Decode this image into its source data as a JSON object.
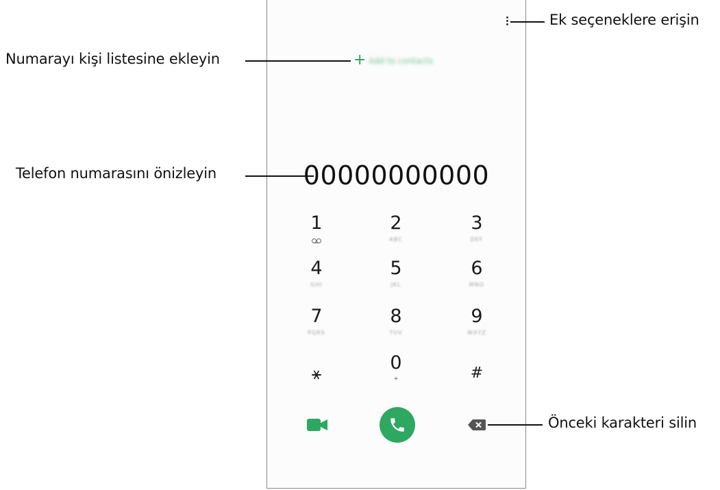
{
  "callouts": {
    "more_options": "Ek seçeneklere erişin",
    "add_to_contacts": "Numarayı kişi listesine ekleyin",
    "preview_number": "Telefon numarasını önizleyin",
    "delete_char": "Önceki karakteri silin"
  },
  "screen": {
    "add_contact_plus": "+",
    "add_contact_label": "Add to contacts",
    "phone_number": "00000000000"
  },
  "keypad": [
    {
      "digit": "1",
      "letters": ""
    },
    {
      "digit": "2",
      "letters": "ABC"
    },
    {
      "digit": "3",
      "letters": "DEF"
    },
    {
      "digit": "4",
      "letters": "GHI"
    },
    {
      "digit": "5",
      "letters": "JKL"
    },
    {
      "digit": "6",
      "letters": "MNO"
    },
    {
      "digit": "7",
      "letters": "PQRS"
    },
    {
      "digit": "8",
      "letters": "TUV"
    },
    {
      "digit": "9",
      "letters": "WXYZ"
    },
    {
      "digit": "⚹",
      "letters": ""
    },
    {
      "digit": "0",
      "letters": "+"
    },
    {
      "digit": "#",
      "letters": ""
    }
  ],
  "icons": {
    "more": "more-options-icon",
    "voicemail": "voicemail-icon",
    "video_call": "video-call-icon",
    "call": "phone-call-icon",
    "backspace": "backspace-icon"
  },
  "colors": {
    "accent_green": "#2ea860",
    "text": "#111111"
  }
}
